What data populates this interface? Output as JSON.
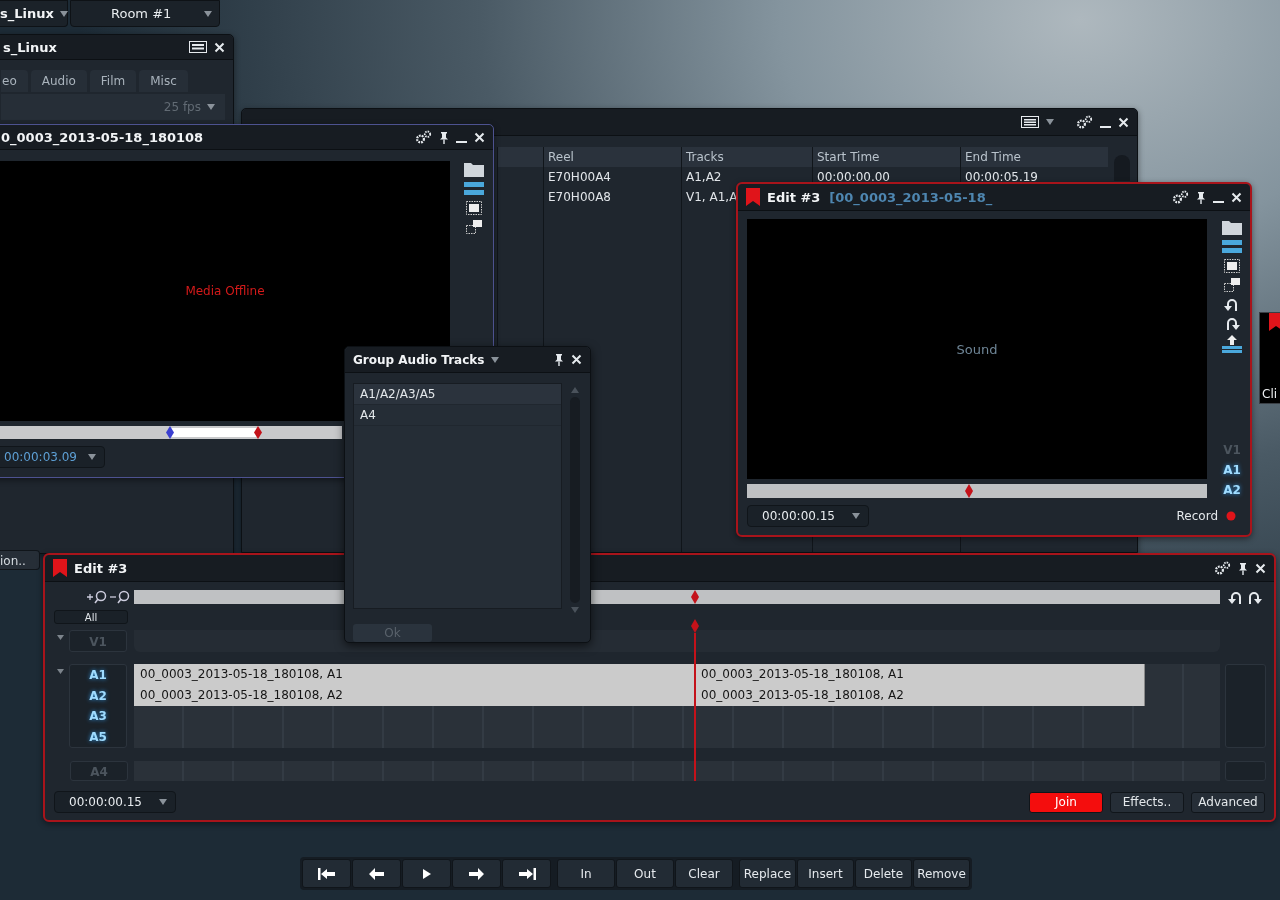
{
  "top_bar": {
    "project": "s_Linux",
    "room": "Room #1"
  },
  "project_panel": {
    "title": "s_Linux",
    "tabs": [
      {
        "label": "eo",
        "selected": false
      },
      {
        "label": "Audio",
        "selected": false
      },
      {
        "label": "Film",
        "selected": false
      },
      {
        "label": "Misc",
        "selected": false
      }
    ],
    "frame_rate": "25 fps",
    "button": "ion.."
  },
  "imports": {
    "columns": [
      "Reel",
      "Tracks",
      "Start Time",
      "End Time"
    ],
    "rows": [
      [
        "E70H00A4",
        "A1,A2",
        "00:00:00.00",
        "00:00:05.19"
      ],
      [
        "E70H00A8",
        "V1, A1,A"
      ]
    ]
  },
  "source_viewer": {
    "title": "0_0003_2013-05-18_180108",
    "message": "Media Offline",
    "timecode": "00:00:03.09"
  },
  "record_viewer": {
    "title": "Edit #3",
    "clip": "[00_0003_2013-05-18_",
    "message": "Sound",
    "level": 0.483,
    "tracks": [
      {
        "label": "V1",
        "on": false
      },
      {
        "label": "A1",
        "on": true
      },
      {
        "label": "A2",
        "on": true
      }
    ],
    "timecode": "00:00:00.15",
    "record_label": "Record"
  },
  "side_window": {
    "label": "Cli"
  },
  "timeline": {
    "title": "Edit #3",
    "level": 0.517,
    "all_label": "All",
    "video_tracks": [
      {
        "label": "V1",
        "on": false
      }
    ],
    "audio_tracks": [
      {
        "label": "A1",
        "on": true,
        "clips": [
          "00_0003_2013-05-18_180108, A1",
          "00_0003_2013-05-18_180108, A1"
        ]
      },
      {
        "label": "A2",
        "on": true,
        "clips": [
          "00_0003_2013-05-18_180108, A2",
          "00_0003_2013-05-18_180108, A2"
        ]
      },
      {
        "label": "A3",
        "on": true
      },
      {
        "label": "A5",
        "on": true
      }
    ],
    "other_tracks": [
      {
        "label": "A4",
        "on": false
      }
    ],
    "timecode": "00:00:00.15",
    "buttons": [
      {
        "label": "Join",
        "highlighted": true
      },
      {
        "label": "Effects..",
        "highlighted": false
      },
      {
        "label": "Advanced",
        "highlighted": false
      }
    ]
  },
  "group_dialog": {
    "title": "Group Audio Tracks",
    "items": [
      "A1/A2/A3/A5",
      "A4"
    ],
    "ok": {
      "label": "Ok",
      "disabled": true
    }
  },
  "transport": {
    "nav": [
      {
        "kind": "start"
      },
      {
        "kind": "back"
      },
      {
        "kind": "play"
      },
      {
        "kind": "forward"
      },
      {
        "kind": "end"
      }
    ],
    "marks": [
      "In",
      "Out",
      "Clear"
    ],
    "edits": [
      "Replace",
      "Insert",
      "Delete",
      "Remove"
    ]
  }
}
